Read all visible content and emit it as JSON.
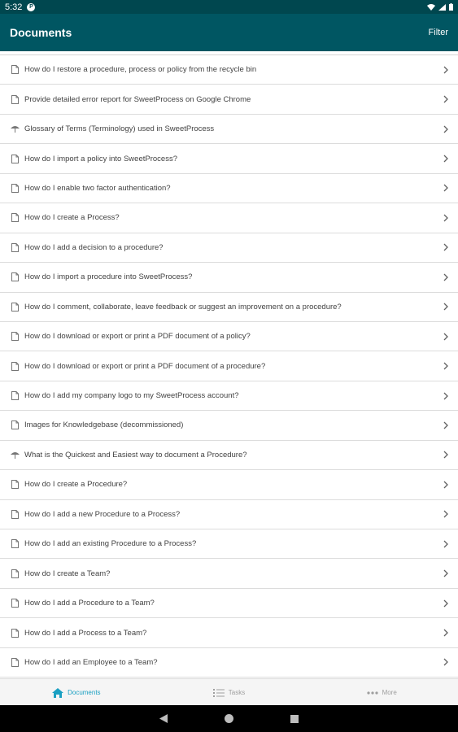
{
  "status": {
    "time": "5:32"
  },
  "appbar": {
    "title": "Documents",
    "filter": "Filter"
  },
  "items": [
    {
      "label": "How do I restore a procedure, process or policy from the recycle bin",
      "icon": "document-icon"
    },
    {
      "label": "Provide detailed error report for SweetProcess on Google Chrome",
      "icon": "document-icon"
    },
    {
      "label": "Glossary of Terms (Terminology) used in SweetProcess",
      "icon": "umbrella-icon"
    },
    {
      "label": "How do I import a policy into SweetProcess?",
      "icon": "document-icon"
    },
    {
      "label": "How do I enable two factor authentication?",
      "icon": "document-icon"
    },
    {
      "label": "How do I create a Process?",
      "icon": "document-icon"
    },
    {
      "label": "How do I add a decision to a procedure?",
      "icon": "document-icon"
    },
    {
      "label": "How do I import a procedure into SweetProcess?",
      "icon": "document-icon"
    },
    {
      "label": "How do I comment, collaborate, leave feedback or suggest an improvement on a procedure?",
      "icon": "document-icon"
    },
    {
      "label": "How do I download or export or print a PDF document of a policy?",
      "icon": "document-icon"
    },
    {
      "label": "How do I download or export or print a PDF document of a procedure?",
      "icon": "document-icon"
    },
    {
      "label": "How do I add my company logo to my SweetProcess account?",
      "icon": "document-icon"
    },
    {
      "label": "Images for Knowledgebase (decommissioned)",
      "icon": "document-icon"
    },
    {
      "label": "What is the Quickest and Easiest way to document a Procedure?",
      "icon": "umbrella-icon"
    },
    {
      "label": "How do I create a Procedure?",
      "icon": "document-icon"
    },
    {
      "label": "How do I add a new Procedure to a Process?",
      "icon": "document-icon"
    },
    {
      "label": "How do I add an existing Procedure to a Process?",
      "icon": "document-icon"
    },
    {
      "label": "How do I create a Team?",
      "icon": "document-icon"
    },
    {
      "label": "How do I add a Procedure to a Team?",
      "icon": "document-icon"
    },
    {
      "label": "How do I add a Process to a Team?",
      "icon": "document-icon"
    },
    {
      "label": "How do I add an Employee to a Team?",
      "icon": "document-icon"
    }
  ],
  "bottom_nav": {
    "documents": "Documents",
    "tasks": "Tasks",
    "more": "More"
  },
  "colors": {
    "appbar": "#005662",
    "status": "#00474f",
    "active": "#1ba0c2"
  }
}
